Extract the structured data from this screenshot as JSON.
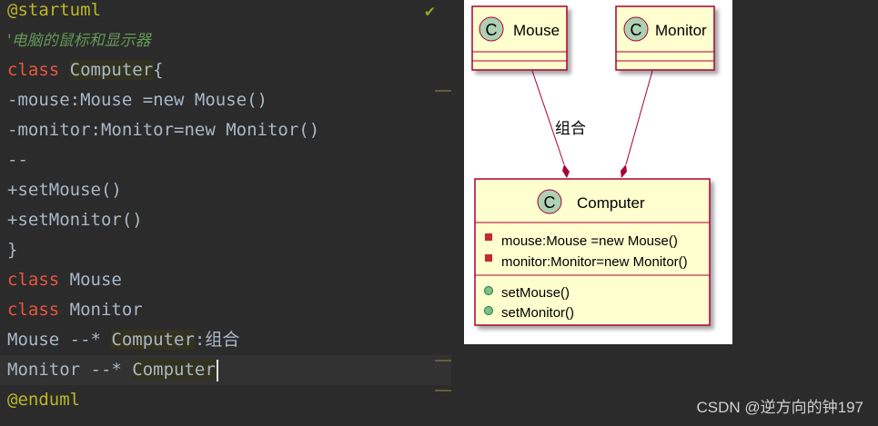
{
  "editor": {
    "lines": [
      "@startuml",
      "'电脑的鼠标和显示器",
      "class Computer{",
      "-mouse:Mouse =new Mouse()",
      "-monitor:Monitor=new Monitor()",
      "--",
      "+setMouse()",
      "+setMonitor()",
      "}",
      "class Mouse",
      "class Monitor",
      "Mouse --* Computer:组合",
      "Monitor --* Computer",
      "@enduml"
    ],
    "tokens": {
      "class_kw": "class",
      "computer": "Computer",
      "brace_open": "{",
      "mouse": "Mouse",
      "monitor": "Monitor",
      "mouse_rel": "Mouse --* ",
      "monitor_rel": "Monitor --* ",
      "rel_label": ":组合"
    }
  },
  "diagram": {
    "classes": [
      {
        "name": "Mouse",
        "stereotype": "C"
      },
      {
        "name": "Monitor",
        "stereotype": "C"
      },
      {
        "name": "Computer",
        "stereotype": "C"
      }
    ],
    "computer_fields": [
      "mouse:Mouse =new Mouse()",
      "monitor:Monitor=new Monitor()"
    ],
    "computer_methods": [
      "setMouse()",
      "setMonitor()"
    ],
    "relation_label": "组合",
    "colors": {
      "class_fill": "#fefece",
      "class_border": "#a80036",
      "circle_fill": "#add1b2",
      "line": "#a80036",
      "private": "#c82930",
      "public": "#84be84"
    }
  },
  "watermark": "CSDN @逆方向的钟197"
}
